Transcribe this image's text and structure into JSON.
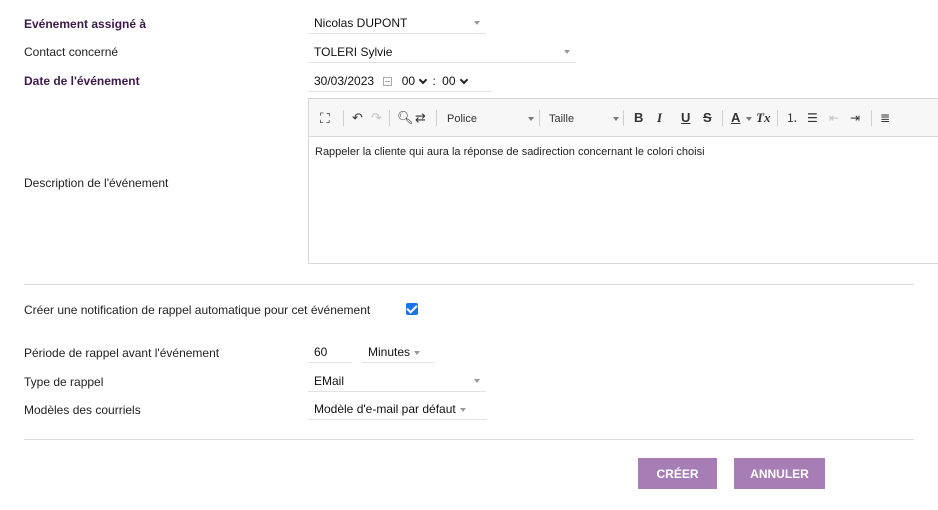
{
  "form": {
    "assignee": {
      "label": "Evénement assigné à",
      "value": "Nicolas DUPONT"
    },
    "contact": {
      "label": "Contact concerné",
      "value": "TOLERI Sylvie"
    },
    "date": {
      "label": "Date de l'événement",
      "value": "30/03/2023",
      "hour": "00",
      "separator": ":",
      "minute": "00"
    },
    "description": {
      "label": "Description de l'événement",
      "content": "Rappeler la cliente qui aura la réponse de sadirection concernant le colori choisi",
      "toolbar": {
        "font_label": "Police",
        "size_label": "Taille",
        "bold": "B",
        "italic": "I",
        "underline": "U",
        "strike": "S",
        "text_color": "A",
        "clear_format": "Tx"
      }
    },
    "reminder": {
      "checkbox_label": "Créer une notification de rappel automatique pour cet événement",
      "checked": true,
      "period": {
        "label": "Période de rappel avant l'événement",
        "value": "60",
        "unit": "Minutes"
      },
      "type": {
        "label": "Type de rappel",
        "value": "EMail"
      },
      "template": {
        "label": "Modèles des courriels",
        "value": "Modèle d'e-mail par défaut"
      }
    }
  },
  "actions": {
    "create_label": "CRÉER",
    "cancel_label": "ANNULER"
  },
  "colors": {
    "button": "#a67db5",
    "required_label": "#3d1a4a",
    "checkbox": "#1a73e8"
  }
}
